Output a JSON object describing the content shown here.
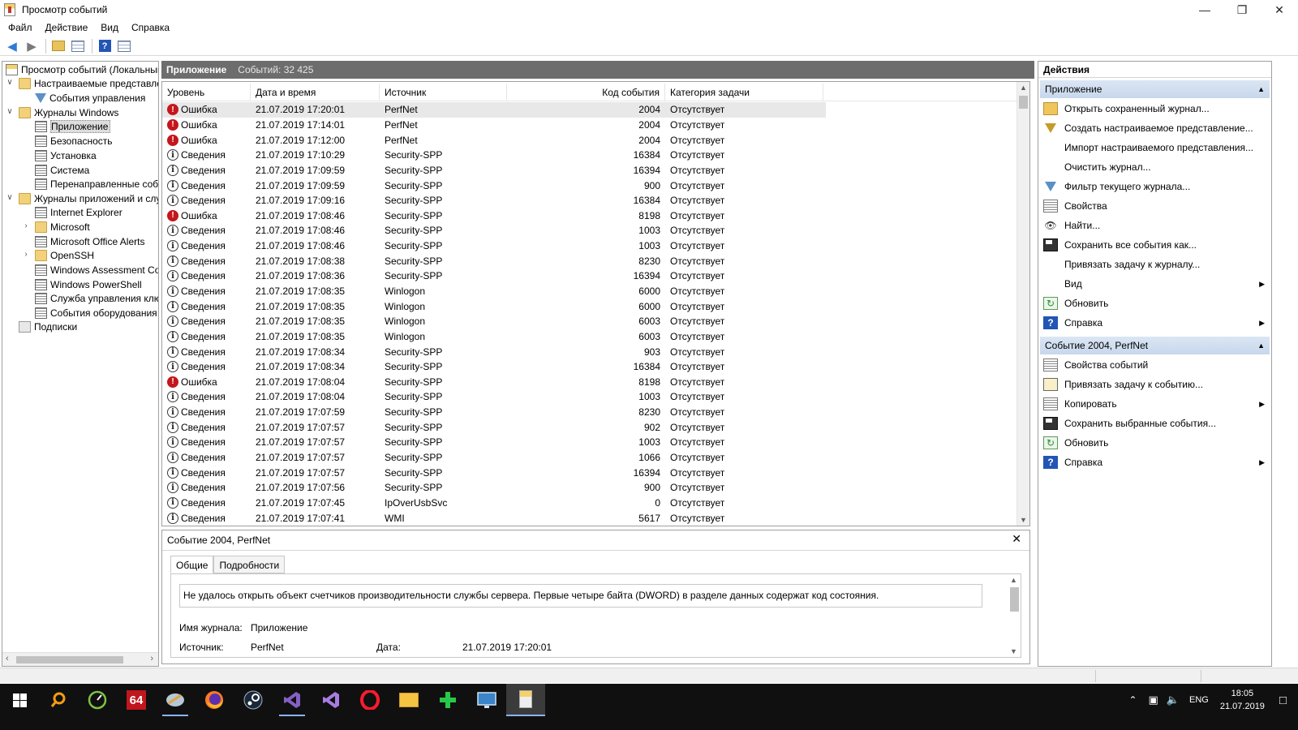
{
  "window": {
    "title": "Просмотр событий",
    "minimize": "—",
    "maximize": "❐",
    "close": "✕"
  },
  "menu": [
    "Файл",
    "Действие",
    "Вид",
    "Справка"
  ],
  "toolbar": {
    "back_icon": "back-arrow-icon",
    "forward_icon": "forward-arrow-icon",
    "folder_icon": "folder-up-icon",
    "grid_icon": "console-tree-icon",
    "help_icon": "help-icon",
    "help_label": "?",
    "pane_icon": "action-pane-icon"
  },
  "tree": {
    "root": "Просмотр событий (Локальный)",
    "custom_views": "Настраиваемые представления",
    "admin_events": "События управления",
    "windows_logs": "Журналы Windows",
    "win_logs": [
      "Приложение",
      "Безопасность",
      "Установка",
      "Система",
      "Перенаправленные события"
    ],
    "apps_services": "Журналы приложений и служб",
    "app_logs": [
      {
        "label": "Internet Explorer",
        "type": "log"
      },
      {
        "label": "Microsoft",
        "type": "folder"
      },
      {
        "label": "Microsoft Office Alerts",
        "type": "log"
      },
      {
        "label": "OpenSSH",
        "type": "folder"
      },
      {
        "label": "Windows Assessment Console",
        "type": "log"
      },
      {
        "label": "Windows PowerShell",
        "type": "log"
      },
      {
        "label": "Служба управления ключами",
        "type": "log"
      },
      {
        "label": "События оборудования",
        "type": "log"
      }
    ],
    "subscriptions": "Подписки"
  },
  "center": {
    "title": "Приложение",
    "count": "Событий: 32 425"
  },
  "columns": [
    "Уровень",
    "Дата и время",
    "Источник",
    "Код события",
    "Категория задачи"
  ],
  "events": [
    {
      "level": "Ошибка",
      "type": "error",
      "date": "21.07.2019 17:20:01",
      "source": "PerfNet",
      "code": "2004",
      "category": "Отсутствует"
    },
    {
      "level": "Ошибка",
      "type": "error",
      "date": "21.07.2019 17:14:01",
      "source": "PerfNet",
      "code": "2004",
      "category": "Отсутствует"
    },
    {
      "level": "Ошибка",
      "type": "error",
      "date": "21.07.2019 17:12:00",
      "source": "PerfNet",
      "code": "2004",
      "category": "Отсутствует"
    },
    {
      "level": "Сведения",
      "type": "info",
      "date": "21.07.2019 17:10:29",
      "source": "Security-SPP",
      "code": "16384",
      "category": "Отсутствует"
    },
    {
      "level": "Сведения",
      "type": "info",
      "date": "21.07.2019 17:09:59",
      "source": "Security-SPP",
      "code": "16394",
      "category": "Отсутствует"
    },
    {
      "level": "Сведения",
      "type": "info",
      "date": "21.07.2019 17:09:59",
      "source": "Security-SPP",
      "code": "900",
      "category": "Отсутствует"
    },
    {
      "level": "Сведения",
      "type": "info",
      "date": "21.07.2019 17:09:16",
      "source": "Security-SPP",
      "code": "16384",
      "category": "Отсутствует"
    },
    {
      "level": "Ошибка",
      "type": "error",
      "date": "21.07.2019 17:08:46",
      "source": "Security-SPP",
      "code": "8198",
      "category": "Отсутствует"
    },
    {
      "level": "Сведения",
      "type": "info",
      "date": "21.07.2019 17:08:46",
      "source": "Security-SPP",
      "code": "1003",
      "category": "Отсутствует"
    },
    {
      "level": "Сведения",
      "type": "info",
      "date": "21.07.2019 17:08:46",
      "source": "Security-SPP",
      "code": "1003",
      "category": "Отсутствует"
    },
    {
      "level": "Сведения",
      "type": "info",
      "date": "21.07.2019 17:08:38",
      "source": "Security-SPP",
      "code": "8230",
      "category": "Отсутствует"
    },
    {
      "level": "Сведения",
      "type": "info",
      "date": "21.07.2019 17:08:36",
      "source": "Security-SPP",
      "code": "16394",
      "category": "Отсутствует"
    },
    {
      "level": "Сведения",
      "type": "info",
      "date": "21.07.2019 17:08:35",
      "source": "Winlogon",
      "code": "6000",
      "category": "Отсутствует"
    },
    {
      "level": "Сведения",
      "type": "info",
      "date": "21.07.2019 17:08:35",
      "source": "Winlogon",
      "code": "6000",
      "category": "Отсутствует"
    },
    {
      "level": "Сведения",
      "type": "info",
      "date": "21.07.2019 17:08:35",
      "source": "Winlogon",
      "code": "6003",
      "category": "Отсутствует"
    },
    {
      "level": "Сведения",
      "type": "info",
      "date": "21.07.2019 17:08:35",
      "source": "Winlogon",
      "code": "6003",
      "category": "Отсутствует"
    },
    {
      "level": "Сведения",
      "type": "info",
      "date": "21.07.2019 17:08:34",
      "source": "Security-SPP",
      "code": "903",
      "category": "Отсутствует"
    },
    {
      "level": "Сведения",
      "type": "info",
      "date": "21.07.2019 17:08:34",
      "source": "Security-SPP",
      "code": "16384",
      "category": "Отсутствует"
    },
    {
      "level": "Ошибка",
      "type": "error",
      "date": "21.07.2019 17:08:04",
      "source": "Security-SPP",
      "code": "8198",
      "category": "Отсутствует"
    },
    {
      "level": "Сведения",
      "type": "info",
      "date": "21.07.2019 17:08:04",
      "source": "Security-SPP",
      "code": "1003",
      "category": "Отсутствует"
    },
    {
      "level": "Сведения",
      "type": "info",
      "date": "21.07.2019 17:07:59",
      "source": "Security-SPP",
      "code": "8230",
      "category": "Отсутствует"
    },
    {
      "level": "Сведения",
      "type": "info",
      "date": "21.07.2019 17:07:57",
      "source": "Security-SPP",
      "code": "902",
      "category": "Отсутствует"
    },
    {
      "level": "Сведения",
      "type": "info",
      "date": "21.07.2019 17:07:57",
      "source": "Security-SPP",
      "code": "1003",
      "category": "Отсутствует"
    },
    {
      "level": "Сведения",
      "type": "info",
      "date": "21.07.2019 17:07:57",
      "source": "Security-SPP",
      "code": "1066",
      "category": "Отсутствует"
    },
    {
      "level": "Сведения",
      "type": "info",
      "date": "21.07.2019 17:07:57",
      "source": "Security-SPP",
      "code": "16394",
      "category": "Отсутствует"
    },
    {
      "level": "Сведения",
      "type": "info",
      "date": "21.07.2019 17:07:56",
      "source": "Security-SPP",
      "code": "900",
      "category": "Отсутствует"
    },
    {
      "level": "Сведения",
      "type": "info",
      "date": "21.07.2019 17:07:45",
      "source": "IpOverUsbSvc",
      "code": "0",
      "category": "Отсутствует"
    },
    {
      "level": "Сведения",
      "type": "info",
      "date": "21.07.2019 17:07:41",
      "source": "WMI",
      "code": "5617",
      "category": "Отсутствует"
    }
  ],
  "detail": {
    "title": "Событие 2004, PerfNet",
    "close": "✕",
    "tabs": [
      "Общие",
      "Подробности"
    ],
    "description": "Не удалось открыть объект счетчиков производительности службы сервера. Первые четыре байта (DWORD) в разделе данных содержат код состояния.",
    "log_name_label": "Имя журнала:",
    "log_name_value": "Приложение",
    "source_label": "Источник:",
    "source_value": "PerfNet",
    "date_label": "Дата:",
    "date_value": "21.07.2019 17:20:01"
  },
  "actions": {
    "title": "Действия",
    "section1": "Приложение",
    "section1_items": [
      {
        "label": "Открыть сохраненный журнал...",
        "icon": "open-log-icon",
        "submenu": false
      },
      {
        "label": "Создать настраиваемое представление...",
        "icon": "create-view-icon",
        "submenu": false
      },
      {
        "label": "Импорт настраиваемого представления...",
        "icon": "",
        "submenu": false
      },
      {
        "label": "Очистить журнал...",
        "icon": "",
        "submenu": false
      },
      {
        "label": "Фильтр текущего журнала...",
        "icon": "filter-icon",
        "submenu": false
      },
      {
        "label": "Свойства",
        "icon": "properties-icon",
        "submenu": false
      },
      {
        "label": "Найти...",
        "icon": "find-icon",
        "submenu": false
      },
      {
        "label": "Сохранить все события как...",
        "icon": "save-icon",
        "submenu": false
      },
      {
        "label": "Привязать задачу к журналу...",
        "icon": "",
        "submenu": false
      },
      {
        "label": "Вид",
        "icon": "",
        "submenu": true
      },
      {
        "label": "Обновить",
        "icon": "refresh-icon",
        "submenu": false
      },
      {
        "label": "Справка",
        "icon": "help-icon",
        "submenu": true
      }
    ],
    "section2": "Событие 2004, PerfNet",
    "section2_items": [
      {
        "label": "Свойства событий",
        "icon": "event-properties-icon",
        "submenu": false
      },
      {
        "label": "Привязать задачу к событию...",
        "icon": "attach-task-icon",
        "submenu": false
      },
      {
        "label": "Копировать",
        "icon": "copy-icon",
        "submenu": true
      },
      {
        "label": "Сохранить выбранные события...",
        "icon": "save-icon",
        "submenu": false
      },
      {
        "label": "Обновить",
        "icon": "refresh-icon",
        "submenu": false
      },
      {
        "label": "Справка",
        "icon": "help-icon",
        "submenu": true
      }
    ]
  },
  "taskbar": {
    "apps": [
      "start-icon",
      "search-icon",
      "speedometer-icon",
      "aida64-icon",
      "app-icon",
      "firefox-icon",
      "steam-icon",
      "visual-studio-icon",
      "visual-studio-2-icon",
      "opera-icon",
      "explorer-icon",
      "plus-icon",
      "display-icon",
      "event-viewer-icon"
    ],
    "aida_label": "64",
    "lang": "ENG",
    "time": "18:05",
    "date": "21.07.2019"
  }
}
